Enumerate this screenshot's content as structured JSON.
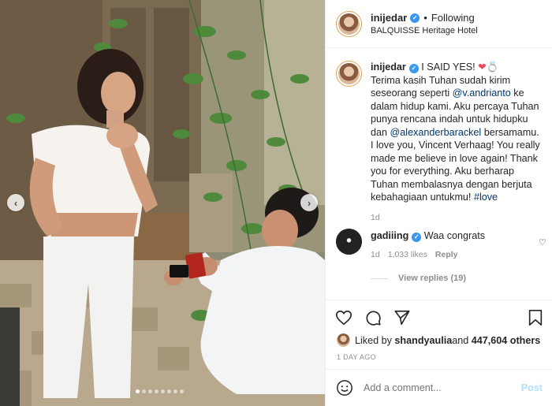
{
  "post": {
    "username": "inijedar",
    "follow_status": "Following",
    "separator": "•",
    "location": "BALQUISSE Heritage Hotel"
  },
  "caption": {
    "username": "inijedar",
    "text_intro": "I SAID YES!",
    "heart": "❤",
    "ring": "💍",
    "text_1": "Terima kasih Tuhan sudah kirim seseorang seperti ",
    "mention_1": "@v.andrianto",
    "text_2": " ke dalam hidup kami. Aku percaya Tuhan punya rencana indah untuk hidupku dan ",
    "mention_2": "@alexanderbarackel",
    "text_3": " bersamamu. I love you, Vincent Verhaag! You really made me believe in love again! Thank you for everything. Aku berharap Tuhan membalasnya dengan berjuta kebahagiaan untukmu! ",
    "hashtag": "#love",
    "time": "1d"
  },
  "comment": {
    "username": "gadiiing",
    "text": "Waa congrats",
    "time": "1d",
    "likes": "1,033 likes",
    "reply": "Reply",
    "view_replies": "View replies (19)"
  },
  "likes": {
    "prefix": "Liked by ",
    "user": "shandyaulia",
    "middle": " and ",
    "count": "447,604 others"
  },
  "post_time": "1 DAY AGO",
  "add_comment": {
    "placeholder": "Add a comment...",
    "post_label": "Post"
  },
  "carousel": {
    "count": 8,
    "active": 1
  },
  "colors": {
    "link": "#00376b",
    "verified": "#3897f0",
    "muted": "#8e8e8e",
    "post_disabled": "#b2dffc"
  },
  "icons": [
    "heart-icon",
    "comment-icon",
    "share-icon",
    "bookmark-icon",
    "emoji-icon",
    "verified-icon",
    "chevron-left-icon",
    "chevron-right-icon"
  ]
}
